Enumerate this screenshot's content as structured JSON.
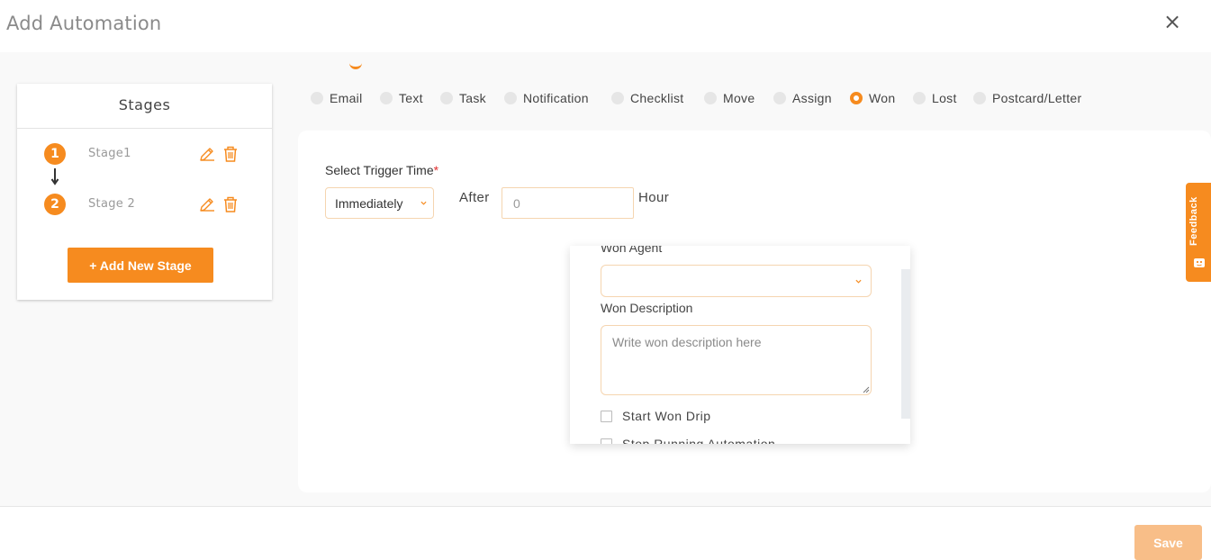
{
  "header": {
    "title": "Add Automation",
    "close_symbol": "×"
  },
  "stages": {
    "title": "Stages",
    "items": [
      {
        "number": "1",
        "name": "Stage1"
      },
      {
        "number": "2",
        "name": "Stage 2"
      }
    ],
    "add_button_label": "+ Add New Stage"
  },
  "actions": {
    "options": [
      "Email",
      "Text",
      "Task",
      "Notification",
      "Checklist",
      "Move",
      "Assign",
      "Won",
      "Lost",
      "Postcard/Letter"
    ],
    "selected": "Won"
  },
  "trigger": {
    "label": "Select Trigger Time",
    "required_mark": "*",
    "selected": "Immediately",
    "after_label": "After",
    "after_placeholder": "0",
    "hour_label": "Hour"
  },
  "won": {
    "agent_label": "Won Agent",
    "agent_value": "",
    "description_label": "Won Description",
    "description_placeholder": "Write won description here",
    "checkboxes": [
      {
        "label": "Start Won Drip",
        "checked": false
      },
      {
        "label": "Stop Running Automation",
        "checked": false
      }
    ]
  },
  "feedback": {
    "label": "Feedback"
  },
  "footer": {
    "save_label": "Save"
  },
  "colors": {
    "accent": "#f68b1f",
    "save_disabled": "#f8be88",
    "required": "#e03030"
  },
  "icons": {
    "close": "close-icon",
    "edit": "pencil-icon",
    "delete": "trash-icon",
    "arrow": "arrow-down-icon",
    "chevron": "chevron-down-icon",
    "feedback": "feedback-icon"
  }
}
